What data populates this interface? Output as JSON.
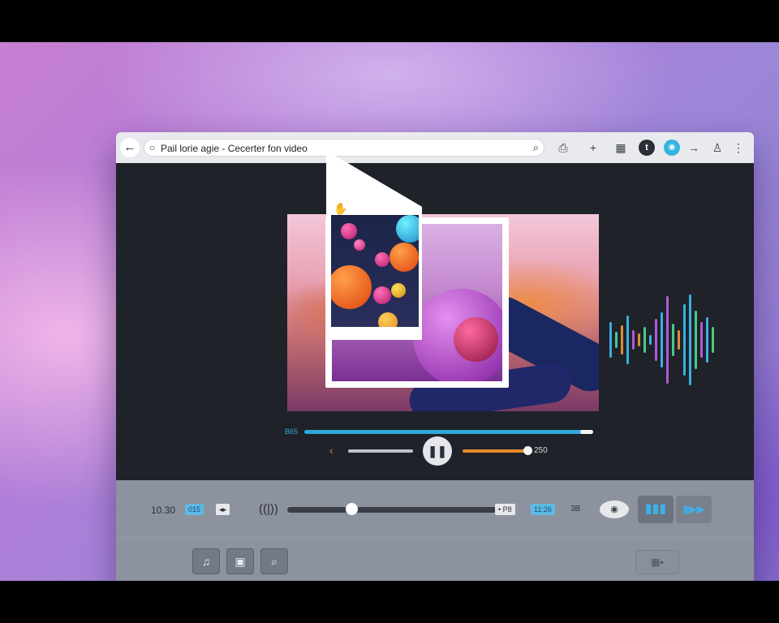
{
  "browser": {
    "url": "Pail lorie agie - Cecerter fon video",
    "icons": [
      "back-arrow-icon",
      "search-icon",
      "share-icon",
      "add-icon",
      "grid-icon",
      "clock-icon",
      "extension-icon",
      "forward-icon",
      "profile-icon",
      "more-icon"
    ]
  },
  "player": {
    "progress_label": "B65",
    "volume_label": "250",
    "progress_fraction": 0.96,
    "volume_fraction": 0.95
  },
  "bottom_bar": {
    "time": "10.30",
    "chip_a": "015",
    "chip_b": "◂▸",
    "end_chip": "• P8",
    "end_chip_2": "11:26",
    "end_chip_3": "3B",
    "seek_fraction": 0.31
  },
  "colors": {
    "accent_blue": "#2fa6d8",
    "accent_orange": "#e58a2e",
    "panel": "#8d939e",
    "player_bg": "#1f2229"
  }
}
